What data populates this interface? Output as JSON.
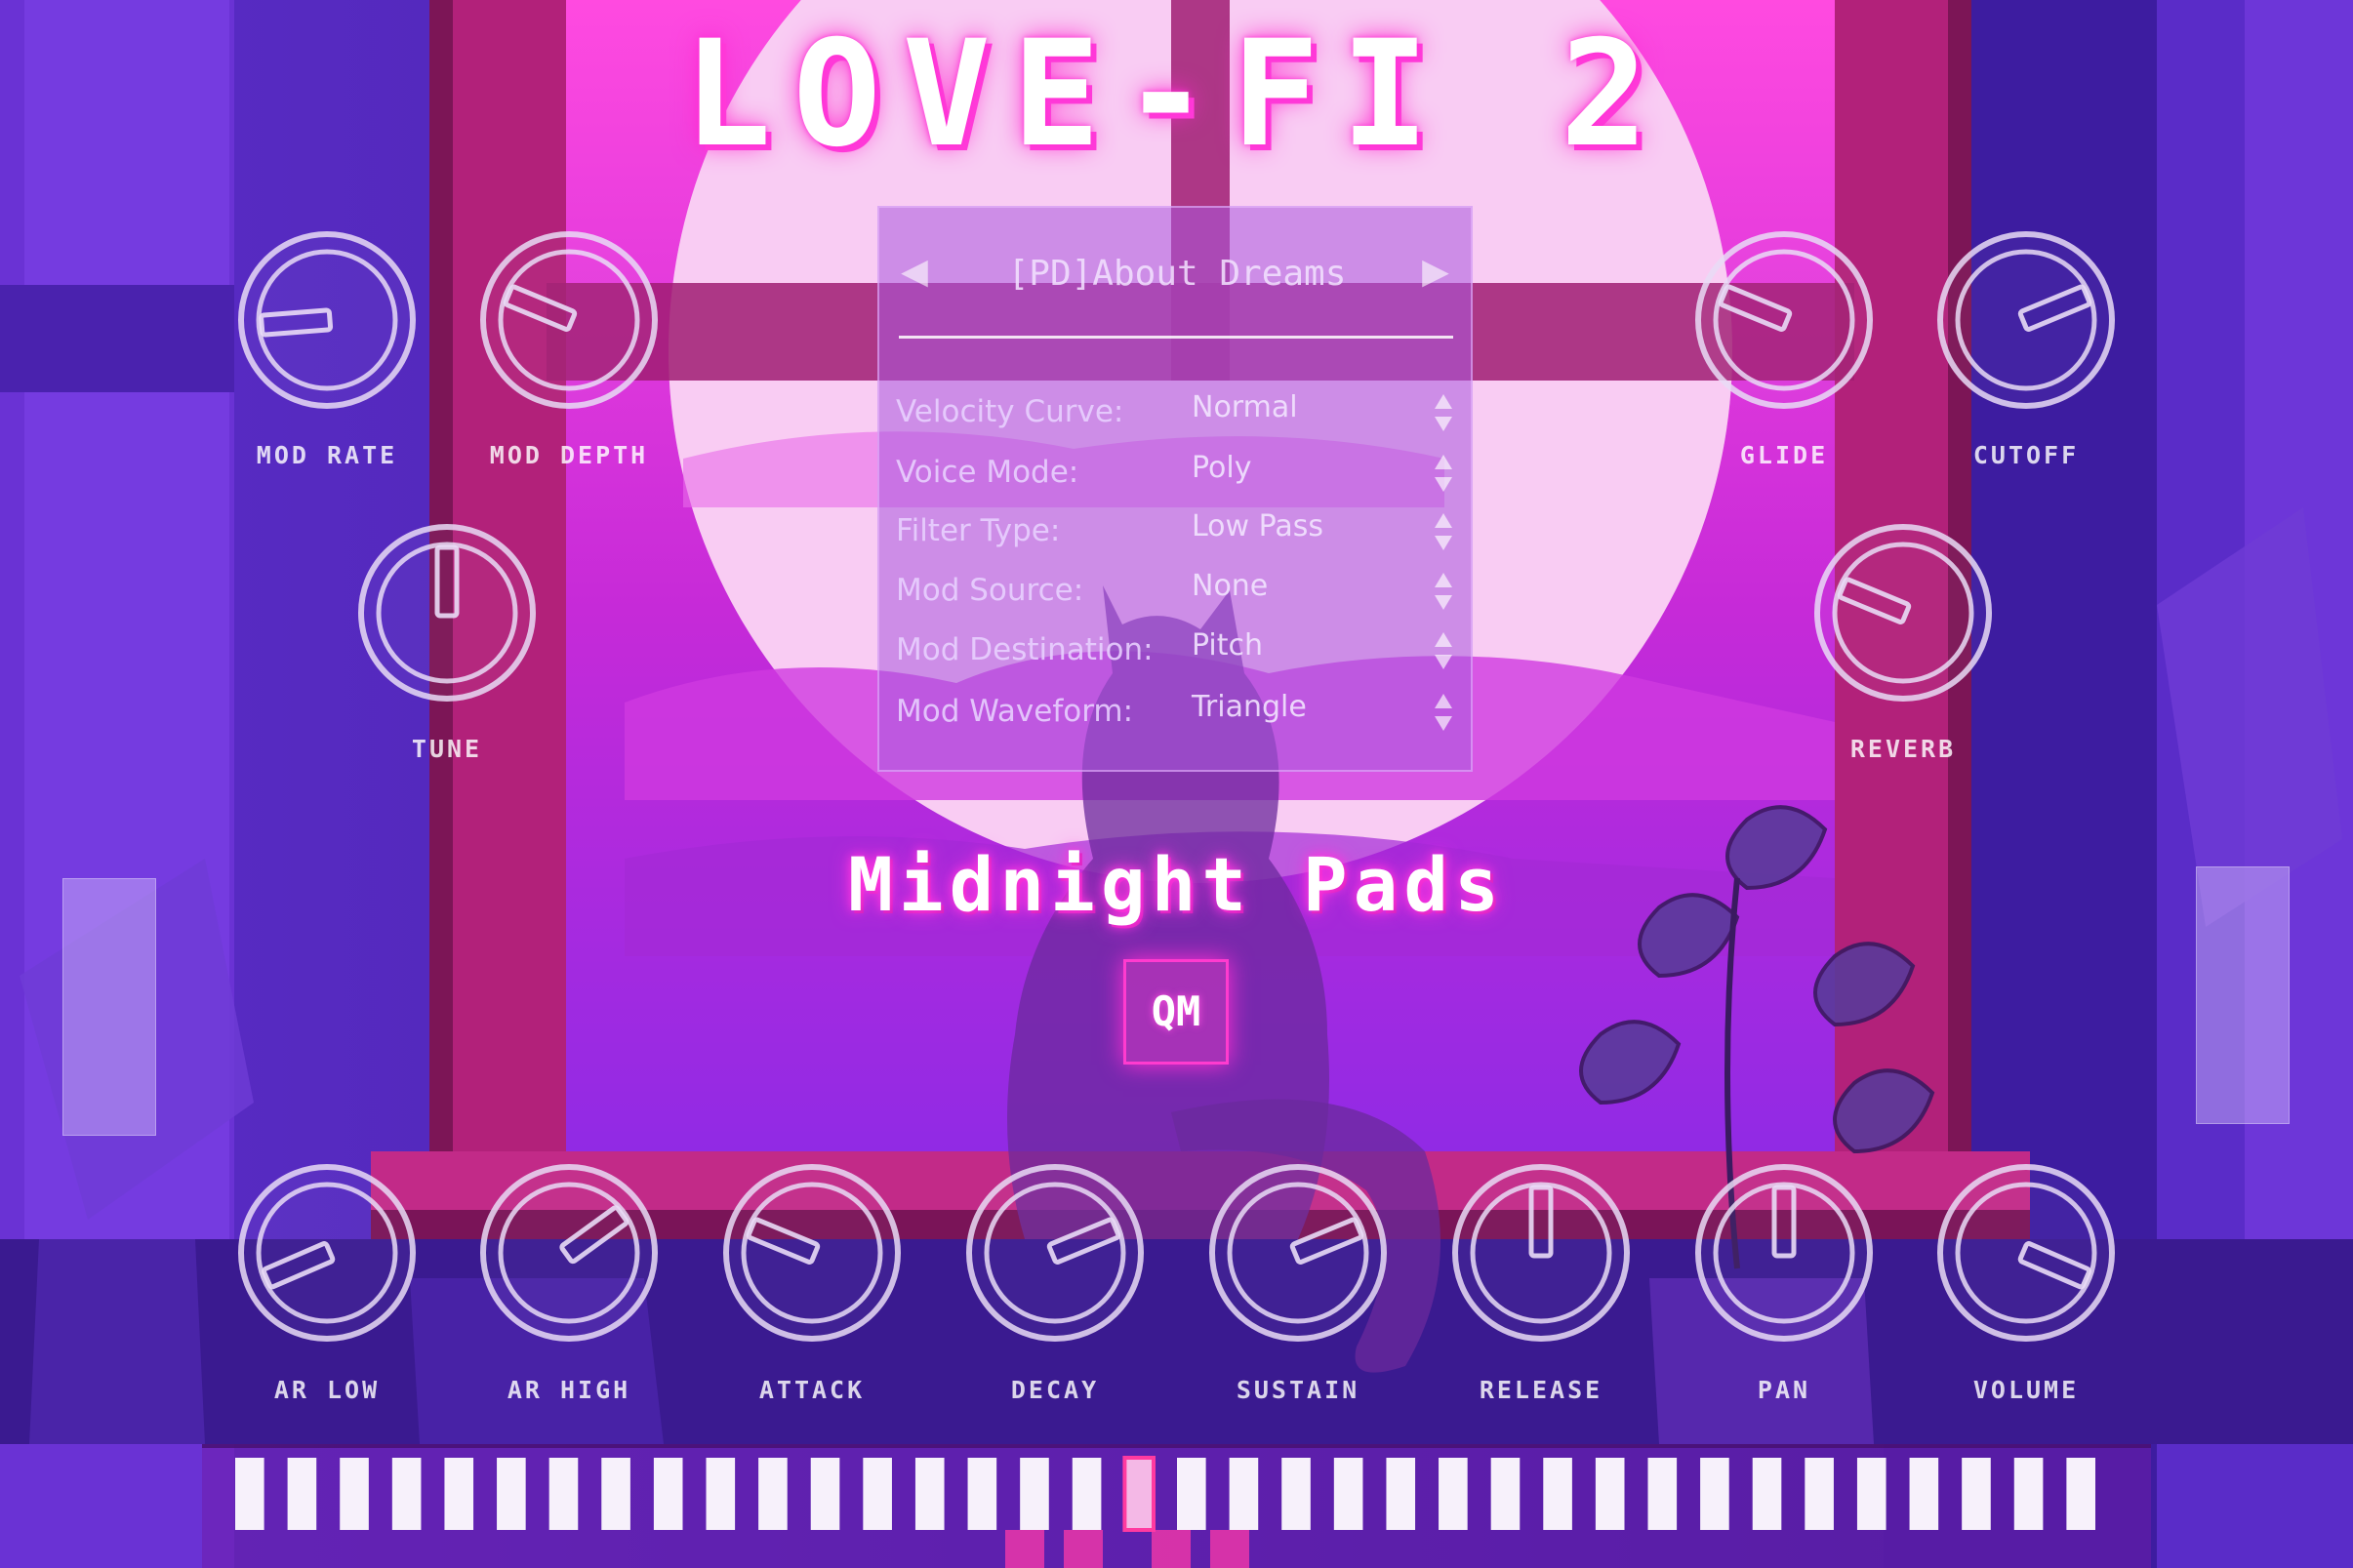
{
  "app": {
    "title": "LOVE-FI 2",
    "patch_name": "Midnight Pads",
    "logo_button": "QM"
  },
  "preset_browser": {
    "prev_icon": "left-triangle-icon",
    "next_icon": "right-triangle-icon",
    "preset_name": "[PD]About Dreams",
    "params": [
      {
        "label": "Velocity Curve:",
        "value": "Normal"
      },
      {
        "label": "Voice Mode:",
        "value": "Poly"
      },
      {
        "label": "Filter Type:",
        "value": "Low Pass"
      },
      {
        "label": "Mod Source:",
        "value": "None"
      },
      {
        "label": "Mod Destination:",
        "value": "Pitch"
      },
      {
        "label": "Mod Waveform:",
        "value": "Triangle"
      }
    ]
  },
  "knobs": {
    "top_left": [
      {
        "label": "MOD RATE",
        "value": 0.15
      },
      {
        "label": "MOD DEPTH",
        "value": 0.25
      },
      {
        "label": "TUNE",
        "value": 0.5
      }
    ],
    "top_right": [
      {
        "label": "GLIDE",
        "value": 0.25
      },
      {
        "label": "CUTOFF",
        "value": 0.75
      },
      {
        "label": "REVERB",
        "value": 0.25
      }
    ],
    "bottom": [
      {
        "label": "AR LOW",
        "value": 0.08
      },
      {
        "label": "AR HIGH",
        "value": 0.7
      },
      {
        "label": "ATTACK",
        "value": 0.25
      },
      {
        "label": "DECAY",
        "value": 0.75
      },
      {
        "label": "SUSTAIN",
        "value": 0.75
      },
      {
        "label": "RELEASE",
        "value": 0.5
      },
      {
        "label": "PAN",
        "value": 0.5
      },
      {
        "label": "VOLUME",
        "value": 0.92
      }
    ]
  },
  "wheels": {
    "pitch": {
      "name": "pitch-wheel"
    },
    "mod": {
      "name": "mod-wheel"
    }
  },
  "keyboard": {
    "white_keys": 36,
    "active_white_key": 17
  },
  "colors": {
    "accent": "#ff35e0",
    "knob_stroke": "#e9dcf6",
    "panel": "#aa5adc"
  }
}
